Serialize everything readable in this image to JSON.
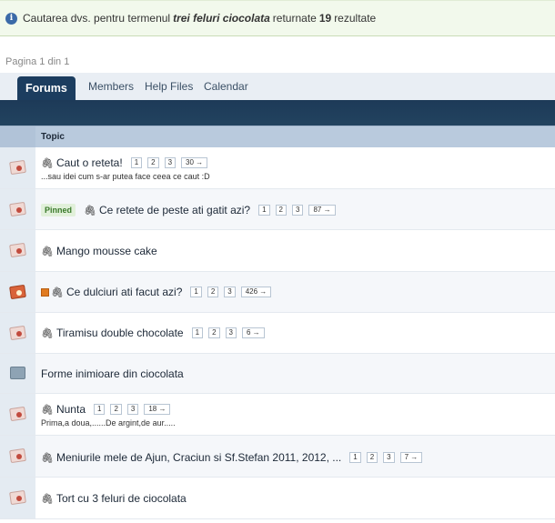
{
  "notice": {
    "prefix": "Cautarea dvs. pentru termenul",
    "term": "trei feluri ciocolata",
    "middle": "returnate",
    "count": "19",
    "suffix": "rezultate"
  },
  "pagination": {
    "label": "Pagina 1 din 1"
  },
  "tabs": [
    {
      "label": "Forums"
    },
    {
      "label": "Members"
    },
    {
      "label": "Help Files"
    },
    {
      "label": "Calendar"
    }
  ],
  "table": {
    "header": "Topic",
    "rows": [
      {
        "title": "Caut o reteta!",
        "desc": "...sau idei cum s-ar putea face ceea ce caut :D",
        "pages": [
          "1",
          "2",
          "3",
          "30 →"
        ]
      },
      {
        "badge": "Pinned",
        "title": "Ce retete de peste ati gatit azi?",
        "pages": [
          "1",
          "2",
          "3",
          "87 →"
        ]
      },
      {
        "title": "Mango mousse cake"
      },
      {
        "title": "Ce dulciuri ati facut azi?",
        "pages": [
          "1",
          "2",
          "3",
          "426 →"
        ]
      },
      {
        "title": "Tiramisu double chocolate",
        "pages": [
          "1",
          "2",
          "3",
          "6 →"
        ]
      },
      {
        "title": "Forme inimioare din ciocolata"
      },
      {
        "title": "Nunta",
        "desc": "Prima,a doua,......De argint,de aur.....",
        "pages": [
          "1",
          "2",
          "3",
          "18 →"
        ]
      },
      {
        "title": "Meniurile mele de Ajun, Craciun si Sf.Stefan 2011, 2012, ...",
        "pages": [
          "1",
          "2",
          "3",
          "7 →"
        ]
      },
      {
        "title": "Tort cu 3 feluri de ciocolata"
      }
    ]
  },
  "icons": {
    "info": "info-icon",
    "attachment": "paperclip-icon",
    "topic": "topic-read-icon",
    "hot": "hot-topic-icon",
    "rss": "rss-icon"
  }
}
